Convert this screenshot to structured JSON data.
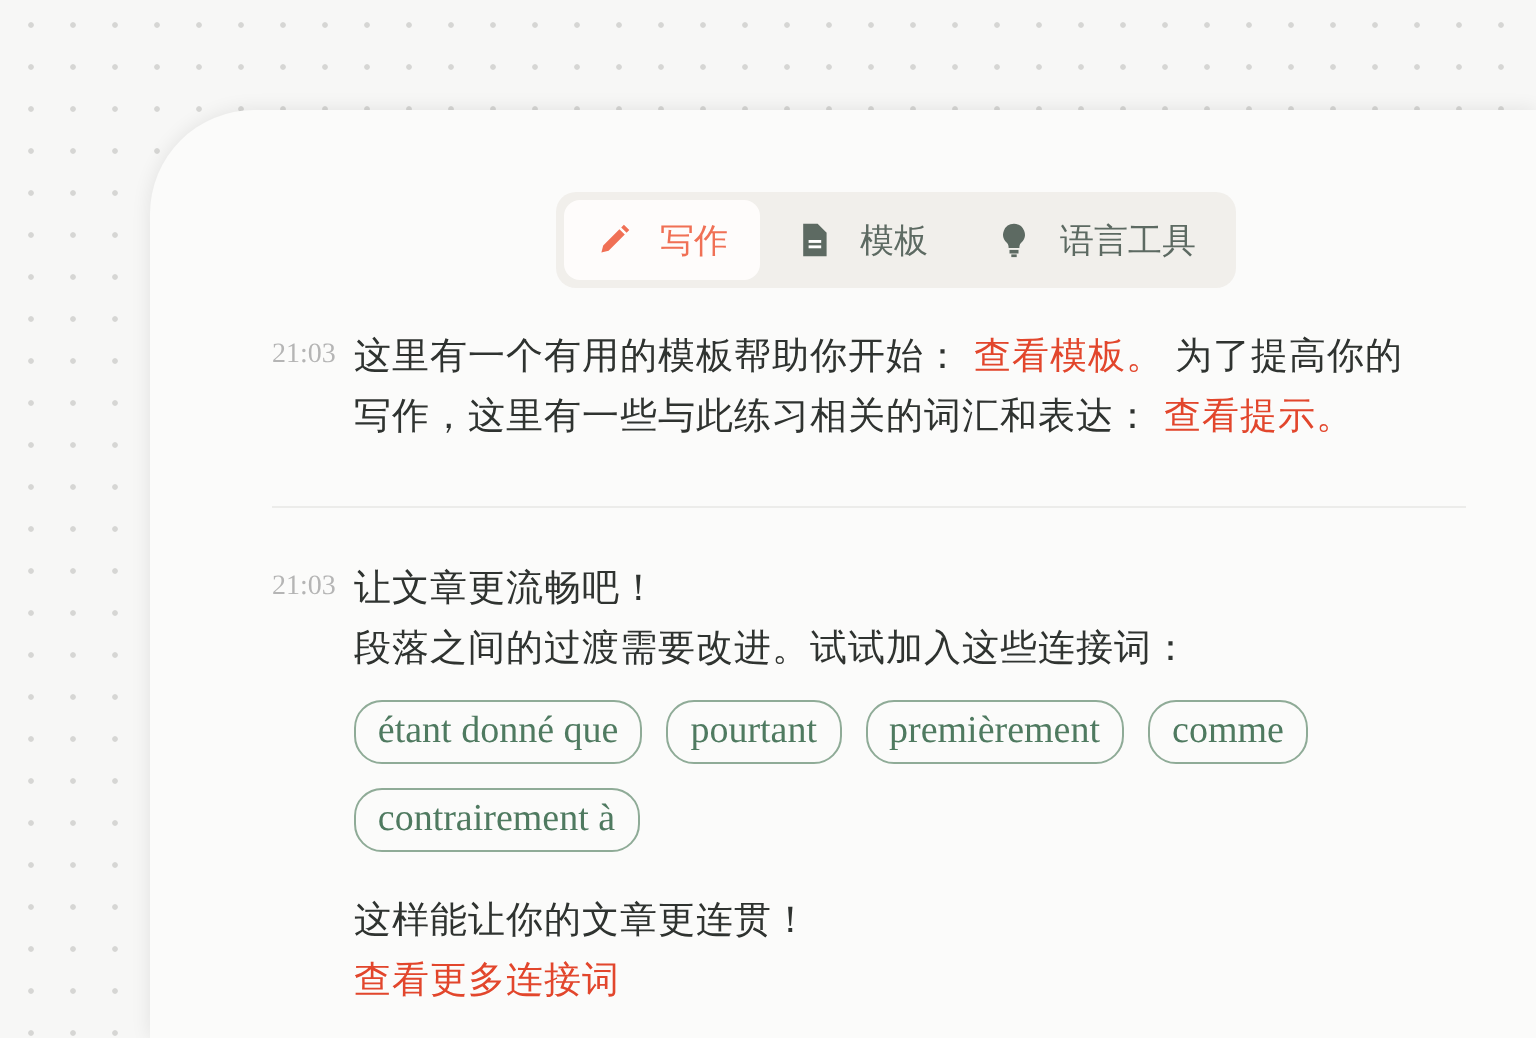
{
  "tabs": [
    {
      "label": "写作",
      "kind": "pencil",
      "selected": true
    },
    {
      "label": "模板",
      "kind": "document",
      "selected": false
    },
    {
      "label": "语言工具",
      "kind": "bulb",
      "selected": false
    }
  ],
  "messages": [
    {
      "time": "21:03",
      "blocks": [
        {
          "kind": "paragraph",
          "segments": [
            {
              "kind": "text",
              "text": "这里有一个有用的模板帮助你开始： "
            },
            {
              "kind": "link",
              "text": "查看模板。"
            },
            {
              "kind": "text",
              "text": " 为了提高你的写作，这里有一些与此练习相关的词汇和表达： "
            },
            {
              "kind": "link",
              "text": "查看提示。"
            }
          ]
        }
      ]
    },
    {
      "time": "21:03",
      "blocks": [
        {
          "kind": "line",
          "text": "让文章更流畅吧！"
        },
        {
          "kind": "line",
          "text": "段落之间的过渡需要改进。试试加入这些连接词："
        },
        {
          "kind": "chips",
          "items": [
            "étant donné que",
            "pourtant",
            "premièrement",
            "comme",
            "contrairement à"
          ]
        },
        {
          "kind": "line",
          "text": "这样能让你的文章更连贯！"
        },
        {
          "kind": "link",
          "text": "查看更多连接词"
        }
      ]
    }
  ]
}
